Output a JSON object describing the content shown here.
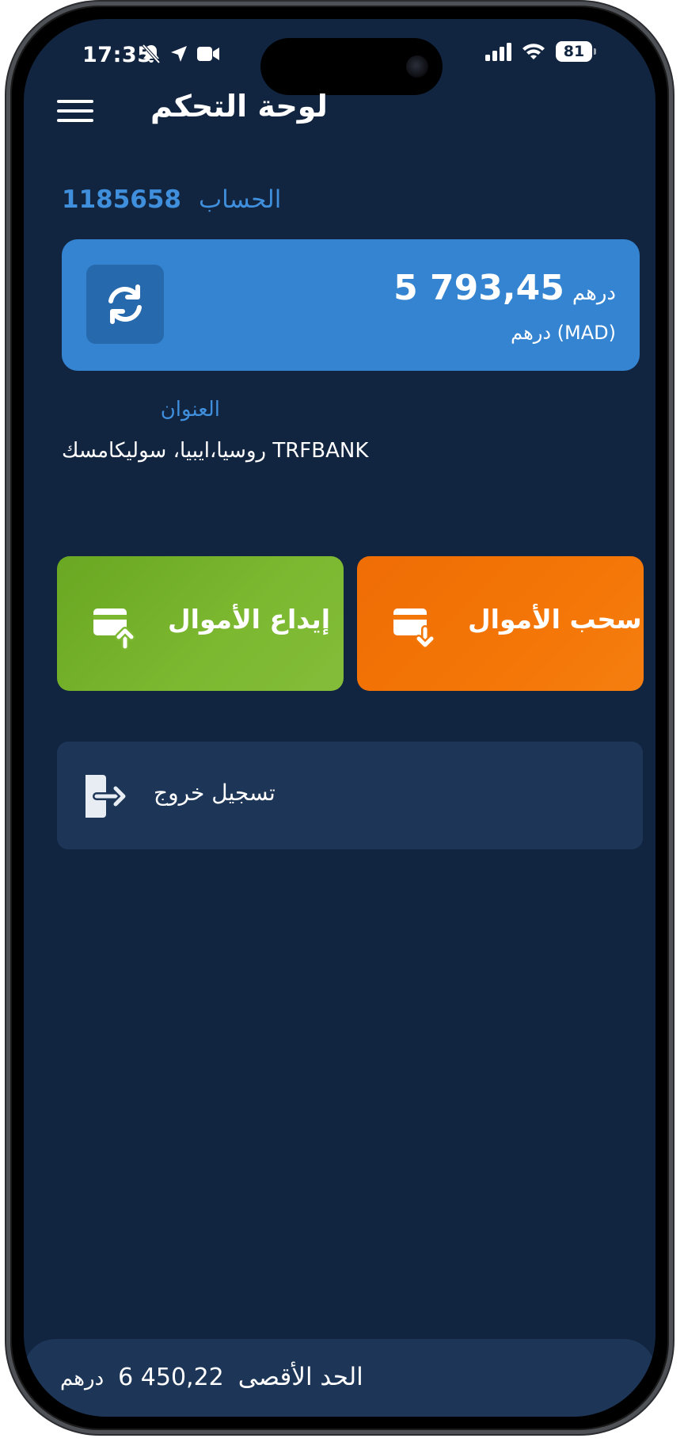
{
  "status_bar": {
    "time": "17:35",
    "battery": "81"
  },
  "header": {
    "title": "لوحة التحكم"
  },
  "account": {
    "label": "الحساب",
    "number": "1185658"
  },
  "balance": {
    "currency": "درهم",
    "amount": "5 793,45",
    "unit": "(MAD) درهم"
  },
  "address": {
    "label": "العنوان",
    "value": "TRFBANK روسيا،ايبيا، سوليكامسك"
  },
  "actions": {
    "deposit_label": "إيداع الأموال",
    "withdraw_label": "سحب الأموال"
  },
  "logout": {
    "label": "تسجيل خروج"
  },
  "footer": {
    "max_label": "الحد الأقصى",
    "max_amount": "6 450,22",
    "max_currency": "درهم"
  },
  "colors": {
    "background": "#112440",
    "accent_blue": "#3484d1",
    "deposit_green": "#7cb830",
    "withdraw_orange": "#f47607",
    "card_dark": "#1d3657"
  },
  "icons": {
    "menu": "hamburger-icon",
    "refresh": "refresh-icon",
    "deposit": "card-upload-icon",
    "withdraw": "card-download-icon",
    "logout": "logout-icon"
  }
}
